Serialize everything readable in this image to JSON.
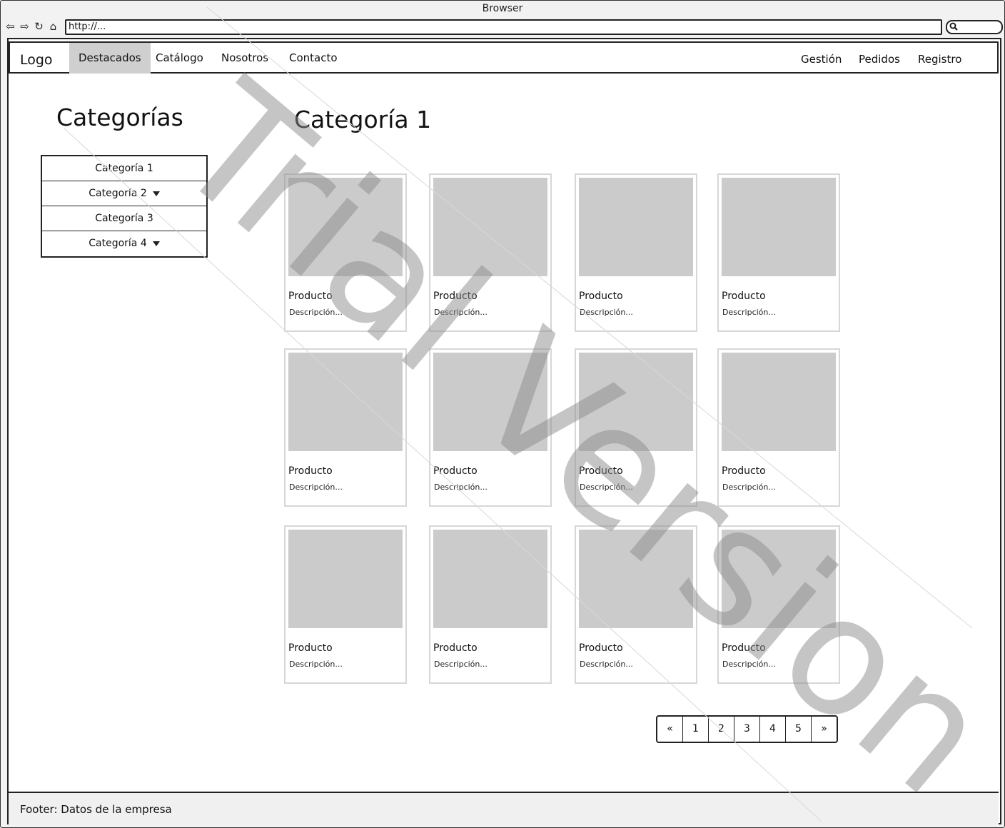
{
  "browser": {
    "title": "Browser",
    "url": "http://...",
    "nav_icons": [
      "back-icon",
      "forward-icon",
      "reload-icon",
      "home-icon"
    ],
    "search_icon": "search-icon"
  },
  "navbar": {
    "logo": "Logo",
    "left_items": [
      "Destacados",
      "Catálogo",
      "Nosotros",
      "Contacto"
    ],
    "right_items": [
      "Gestión",
      "Pedidos",
      "Registro"
    ],
    "active": "Destacados"
  },
  "sidebar": {
    "title": "Categorías",
    "items": [
      {
        "label": "Categoría 1",
        "dropdown": false
      },
      {
        "label": "Categoría 2",
        "dropdown": true
      },
      {
        "label": "Categoría 3",
        "dropdown": false
      },
      {
        "label": "Categoría 4",
        "dropdown": true
      }
    ]
  },
  "main": {
    "title": "Categoría 1",
    "products": [
      {
        "name": "Producto",
        "desc": "Descripción..."
      },
      {
        "name": "Producto",
        "desc": "Descripción..."
      },
      {
        "name": "Producto",
        "desc": "Descripción..."
      },
      {
        "name": "Producto",
        "desc": "Descripción..."
      },
      {
        "name": "Producto",
        "desc": "Descripción..."
      },
      {
        "name": "Producto",
        "desc": "Descripción..."
      },
      {
        "name": "Producto",
        "desc": "Descripción..."
      },
      {
        "name": "Producto",
        "desc": "Descripción..."
      },
      {
        "name": "Producto",
        "desc": "Descripción..."
      },
      {
        "name": "Producto",
        "desc": "Descripción..."
      },
      {
        "name": "Producto",
        "desc": "Descripción..."
      },
      {
        "name": "Producto",
        "desc": "Descripción..."
      }
    ]
  },
  "pagination": [
    "«",
    "1",
    "2",
    "3",
    "4",
    "5",
    "»"
  ],
  "footer": {
    "text": "Footer: Datos de la empresa"
  },
  "watermark": {
    "text": "Trial Version"
  },
  "colors": {
    "placeholder": "#cbcbcb",
    "active_nav": "#cfcfcf",
    "watermark": "#8c8c8c"
  }
}
